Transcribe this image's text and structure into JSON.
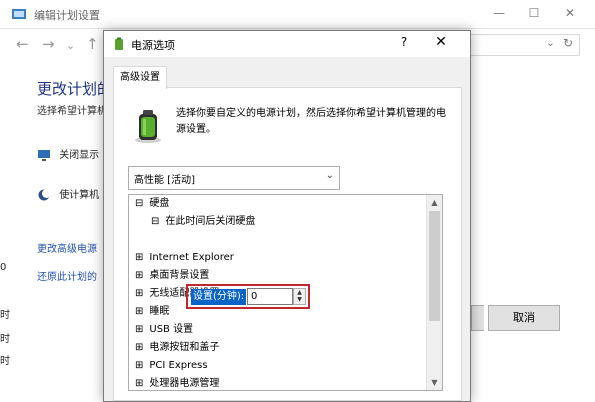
{
  "background_window": {
    "title": "编辑计划设置",
    "controls": {
      "minimize": "—",
      "maximize": "☐",
      "close": "✕"
    },
    "nav": {
      "back": "←",
      "forward": "→",
      "dropdown": "⌄",
      "up": "↑"
    },
    "address": {
      "chevron": "⌄",
      "refresh": "↻"
    },
    "heading": "更改计划的",
    "subtitle": "选择希望计算机",
    "rows": [
      {
        "label": "关闭显示",
        "icon": "monitor-icon"
      },
      {
        "label": "使计算机",
        "icon": "moon-icon"
      }
    ],
    "links": [
      "更改高级电源",
      "还原此计划的"
    ],
    "left_edge_chars": [
      "0",
      "时",
      "时",
      "时"
    ],
    "buttons": {
      "ok": "",
      "cancel": "取消"
    }
  },
  "dialog": {
    "title": "电源选项",
    "help": "?",
    "close": "✕",
    "tab": "高级设置",
    "description": "选择你要自定义的电源计划，然后选择你希望计算机管理的电源设置。",
    "plan_select": {
      "value": "高性能 [活动]",
      "arrow": "⌄"
    },
    "tree": {
      "root": {
        "sign": "⊟",
        "label": "硬盘"
      },
      "child": {
        "sign": "⊟",
        "label": "在此时间后关闭硬盘"
      },
      "setting": {
        "label": "设置(分钟):",
        "value": "0"
      },
      "items": [
        {
          "sign": "⊞",
          "label": "Internet Explorer"
        },
        {
          "sign": "⊞",
          "label": "桌面背景设置"
        },
        {
          "sign": "⊞",
          "label": "无线适配器设置"
        },
        {
          "sign": "⊞",
          "label": "睡眠"
        },
        {
          "sign": "⊞",
          "label": "USB 设置"
        },
        {
          "sign": "⊞",
          "label": "电源按钮和盖子"
        },
        {
          "sign": "⊞",
          "label": "PCI Express"
        },
        {
          "sign": "⊞",
          "label": "处理器电源管理"
        }
      ],
      "scroll_up": "▲",
      "scroll_down": "▼",
      "spin_up": "▲",
      "spin_down": "▼"
    }
  },
  "colors": {
    "accent": "#0a64c8",
    "highlight_border": "#c1272d",
    "heading": "#1e3287",
    "link": "#1e50b4"
  }
}
